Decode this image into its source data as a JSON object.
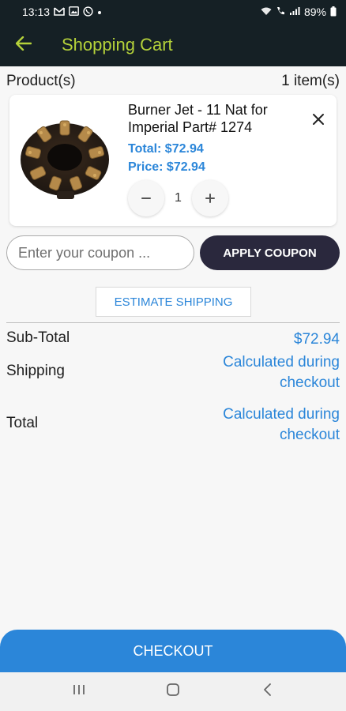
{
  "status_bar": {
    "time": "13:13",
    "battery": "89%",
    "notification_icons": [
      "gmail-icon",
      "image-icon",
      "whatsapp-icon",
      "dot-icon"
    ],
    "system_icons": [
      "wifi-icon",
      "call-icon",
      "signal-icon",
      "battery-icon"
    ]
  },
  "app_bar": {
    "title": "Shopping Cart",
    "back_icon": "arrow-left-icon"
  },
  "colors": {
    "app_bar_bg": "#152025",
    "title": "#b5d23a",
    "accent_blue": "#2b86d9",
    "apply_button_bg": "#2a283d",
    "page_bg": "#f7f7f7"
  },
  "cart": {
    "products_label": "Product(s)",
    "item_count": "1 item(s)",
    "items": [
      {
        "name": "Burner Jet - 11 Nat for Imperial Part# 1274",
        "total": "Total: $72.94",
        "price": "Price: $72.94",
        "quantity": "1",
        "image": "burner-jet-product-image"
      }
    ]
  },
  "coupon": {
    "placeholder": "Enter your coupon ...",
    "value": "",
    "apply_label": "APPLY COUPON"
  },
  "estimate_shipping_label": "ESTIMATE SHIPPING",
  "summary": {
    "subtotal_label": "Sub-Total",
    "subtotal_value": "$72.94",
    "shipping_label": "Shipping",
    "shipping_value": "Calculated during checkout",
    "total_label": "Total",
    "total_value": "Calculated during checkout"
  },
  "checkout_label": "CHECKOUT",
  "nav": [
    "recent-apps-icon",
    "home-icon",
    "back-icon"
  ]
}
